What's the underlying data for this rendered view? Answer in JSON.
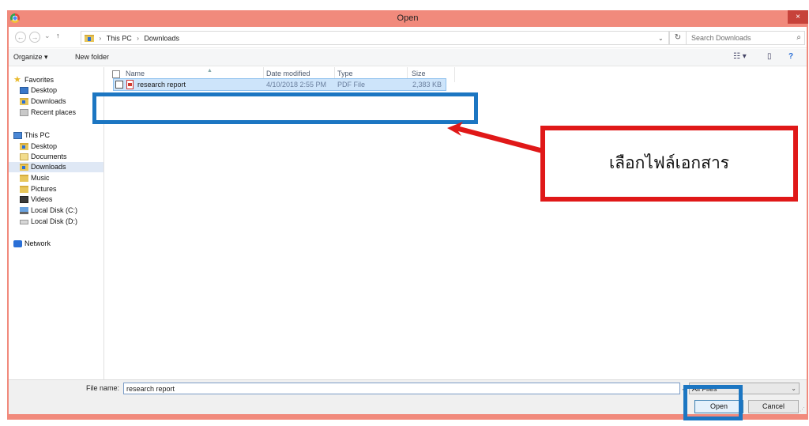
{
  "window": {
    "title": "Open",
    "close_glyph": "×",
    "app_icon": "chrome-icon",
    "frame_color": "#f18a7c"
  },
  "address": {
    "back_glyph": "←",
    "forward_glyph": "→",
    "history_glyph": "⌄",
    "up_glyph": "↑",
    "crumbs": [
      "This PC",
      "Downloads"
    ],
    "crumb_sep": "›",
    "dropdown_glyph": "⌄",
    "refresh_glyph": "↻",
    "search_placeholder": "Search Downloads",
    "search_glyph": "⌕"
  },
  "toolbar": {
    "organize_label": "Organize ▾",
    "new_folder_label": "New folder",
    "view_glyph": "☷ ▾",
    "pane_glyph": "▯",
    "help_glyph": "?"
  },
  "nav": {
    "favorites": "Favorites",
    "desktop": "Desktop",
    "downloads": "Downloads",
    "recent": "Recent places",
    "this_pc": "This PC",
    "pc_desktop": "Desktop",
    "documents": "Documents",
    "pc_downloads": "Downloads",
    "music": "Music",
    "pictures": "Pictures",
    "videos": "Videos",
    "disk_c": "Local Disk (C:)",
    "disk_d": "Local Disk (D:)",
    "network": "Network"
  },
  "columns": {
    "name": "Name",
    "date": "Date modified",
    "type": "Type",
    "size": "Size"
  },
  "file": {
    "name": "research report",
    "date": "4/10/2018 2:55 PM",
    "type": "PDF File",
    "size": "2,383 KB"
  },
  "bottom": {
    "file_name_label": "File name:",
    "file_name_value": "research report",
    "dropdown_glyph": "⌄",
    "filter_value": "All Files",
    "open_label": "Open",
    "cancel_label": "Cancel"
  },
  "annotation": {
    "callout_text": "เลือกไฟล์เอกสาร",
    "highlight_color": "#1c76c2",
    "callout_color": "#e01818"
  }
}
